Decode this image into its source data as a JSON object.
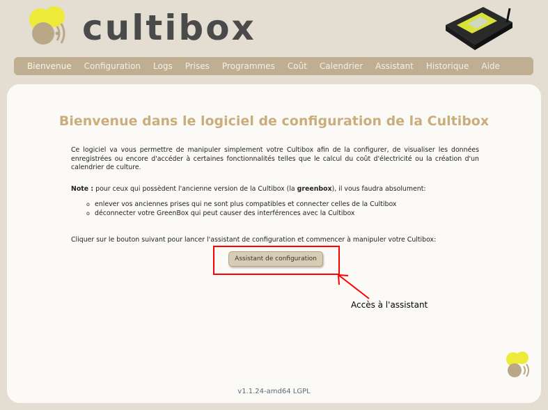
{
  "brand": {
    "name": "cultibox"
  },
  "nav": {
    "items": [
      {
        "label": "Bienvenue",
        "active": true
      },
      {
        "label": "Configuration"
      },
      {
        "label": "Logs"
      },
      {
        "label": "Prises"
      },
      {
        "label": "Programmes"
      },
      {
        "label": "Coût"
      },
      {
        "label": "Calendrier"
      },
      {
        "label": "Assistant"
      },
      {
        "label": "Historique"
      },
      {
        "label": "Aide"
      }
    ]
  },
  "main": {
    "title": "Bienvenue dans le logiciel de configuration de la Cultibox",
    "intro": "Ce logiciel va vous permettre de manipuler simplement votre Cultibox afin de la configurer, de visualiser les données enregistrées ou encore d'accéder à certaines fonctionnalités telles que le calcul du coût d'électricité ou la création d'un calendrier de culture.",
    "note_label": "Note :",
    "note_text_1": " pour ceux qui possèdent l'ancienne version de la Cultibox (la ",
    "note_bold": "greenbox",
    "note_text_2": "), il vous faudra absolument:",
    "bullets": [
      "enlever vos anciennes prises qui ne sont plus compatibles et connecter celles de la Cultibox",
      "déconnecter votre GreenBox qui peut causer des interférences avec la Cultibox"
    ],
    "cta_text": "Cliquer sur le bouton suivant pour lancer l'assistant de configuration et commencer à manipuler votre Cultibox:",
    "cta_button": "Assistant de configuration",
    "annotation": "Accès à l'assistant"
  },
  "footer": {
    "version": "v1.1.24-amd64",
    "license": "LGPL"
  },
  "colors": {
    "background": "#e3ddd2",
    "nav": "#bfae92",
    "title": "#c9ad7c",
    "highlight": "#ff0000",
    "logo_yellow": "#eeea3a",
    "logo_tan": "#b9a788"
  }
}
